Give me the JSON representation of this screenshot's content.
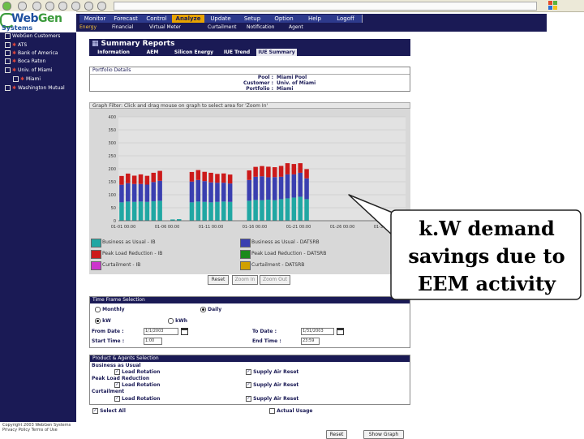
{
  "logo": {
    "main_a": "Web",
    "main_b": "Gen",
    "sub": "Systems"
  },
  "nav": {
    "tabs": [
      "Monitor",
      "Forecast",
      "Control",
      "Analyze",
      "Update",
      "Setup",
      "Option",
      "Help",
      "Logoff"
    ],
    "active": "Analyze",
    "sub_items": [
      "Energy",
      "Financial",
      "Virtual Meter",
      "Curtailment",
      "Notification",
      "Agent"
    ],
    "sub_active": "Energy"
  },
  "sidebar": {
    "items": [
      "WebGen Customers",
      "ATS",
      "Bank of America",
      "Boca Raton",
      "Univ. of Miami",
      "Miami",
      "Washington Mutual"
    ],
    "footer": "Copyright 2003 WebGen Systems Privacy Policy Terms of Use"
  },
  "summary": {
    "title": "Summary Reports",
    "tabs": [
      "Information",
      "AEM",
      "Silicon Energy",
      "IUE Trend",
      "IUE Summary"
    ],
    "active_tab": "IUE Summary"
  },
  "portfolio": {
    "heading": "Portfolio Details",
    "rows": [
      {
        "label": "Pool :",
        "value": "Miami Pool"
      },
      {
        "label": "Customer :",
        "value": "Univ. of Miami"
      },
      {
        "label": "Portfolio :",
        "value": "Miami"
      }
    ]
  },
  "graph_filter": "Graph Filter: Click and drag mouse on graph to select area for 'Zoom In'",
  "chart_data": {
    "type": "bar",
    "stacked": true,
    "ylim": [
      0,
      650
    ],
    "y_ticks": [
      "0",
      "50",
      "100",
      "150",
      "200",
      "250",
      "300",
      "350",
      "400"
    ],
    "x_tick_labels": [
      "01-01 00:00",
      "01-06 00:00",
      "01-11 00:00",
      "01-16 00:00",
      "01-21 00:00",
      "01-26 00:00",
      "01-31 00:00"
    ],
    "categories_count": 45,
    "series": [
      {
        "name": "Business as Usual - IB",
        "color": "#20a7a3",
        "values": [
          115,
          120,
          118,
          120,
          118,
          122,
          125,
          0,
          8,
          10,
          0,
          115,
          120,
          118,
          115,
          118,
          120,
          118,
          0,
          0,
          125,
          130,
          128,
          132,
          128,
          135,
          140,
          145,
          150,
          135,
          0,
          0,
          0,
          0,
          0,
          0,
          0,
          0,
          0,
          0,
          0,
          0,
          0,
          0,
          0
        ]
      },
      {
        "name": "Peak Load Reduction - IB",
        "color": "#3a3fb0",
        "values": [
          110,
          115,
          112,
          110,
          108,
          120,
          125,
          0,
          0,
          0,
          0,
          130,
          135,
          130,
          125,
          120,
          118,
          115,
          0,
          0,
          130,
          145,
          150,
          140,
          145,
          140,
          150,
          145,
          150,
          130,
          0,
          0,
          0,
          0,
          0,
          0,
          0,
          0,
          0,
          0,
          0,
          0,
          0,
          0,
          0
        ]
      },
      {
        "name": "Curtailment - IB",
        "color": "#cc1a1a",
        "values": [
          0,
          0,
          0,
          0,
          0,
          0,
          0,
          0,
          0,
          0,
          0,
          0,
          0,
          0,
          0,
          0,
          0,
          0,
          0,
          0,
          0,
          0,
          0,
          0,
          0,
          0,
          0,
          0,
          0,
          0,
          0,
          0,
          0,
          0,
          0,
          0,
          0,
          0,
          0,
          0,
          0,
          0,
          0,
          0,
          0
        ]
      },
      {
        "name": "Business as Usual - DATSRB",
        "color": "#20a7a3",
        "values": []
      },
      {
        "name": "Peak Load Reduction - DATSRB",
        "color": "#3a3fb0",
        "values": []
      },
      {
        "name": "Curtailment - DATSRB",
        "color": "#cc1a1a",
        "values": []
      }
    ],
    "legend": [
      {
        "label": "Business as Usual - IB",
        "color": "#20a7a3"
      },
      {
        "label": "Peak Load Reduction - IB",
        "color": "#cc1a1a"
      },
      {
        "label": "Curtailment - IB",
        "color": "#cc33cc"
      },
      {
        "label": "Business as Usual - DATSRB",
        "color": "#3a3fb0"
      },
      {
        "label": "Peak Load Reduction - DATSRB",
        "color": "#1a8a1a"
      },
      {
        "label": "Curtailment - DATSRB",
        "color": "#d0a000"
      }
    ]
  },
  "chart_controls": {
    "reset": "Reset",
    "zoom_in": "Zoom In",
    "zoom_out": "Zoom Out"
  },
  "timeframe": {
    "heading": "Time Frame Selection",
    "monthly": "Monthly",
    "daily": "Daily",
    "kw": "kW",
    "kwh": "kWh",
    "from_label": "From Date :",
    "from_value": "1/1/2003",
    "to_label": "To Date :",
    "to_value": "1/31/2003",
    "start_label": "Start Time :",
    "start_value": "1:00",
    "end_label": "End Time :",
    "end_value": "23:59"
  },
  "products": {
    "heading": "Product & Agents Selection",
    "groups": [
      {
        "name": "Business as Usual",
        "items": [
          "Load Rotation",
          "Supply Air Reset"
        ]
      },
      {
        "name": "Peak Load Reduction",
        "items": [
          "Load Rotation",
          "Supply Air Reset"
        ]
      },
      {
        "name": "Curtailment",
        "items": [
          "Load Rotation",
          "Supply Air Reset"
        ]
      }
    ],
    "select_all": "Select All",
    "actual_usage": "Actual Usage"
  },
  "actions": {
    "reset": "Reset",
    "show_graph": "Show Graph"
  },
  "callout": {
    "line1": "k.W demand",
    "line2": "savings due to",
    "line3": "EEM activity"
  },
  "colors": {
    "navy": "#1a1a55",
    "accent": "#e8a400",
    "teal": "#20a7a3",
    "blue": "#3a3fb0",
    "red": "#cc1a1a"
  }
}
